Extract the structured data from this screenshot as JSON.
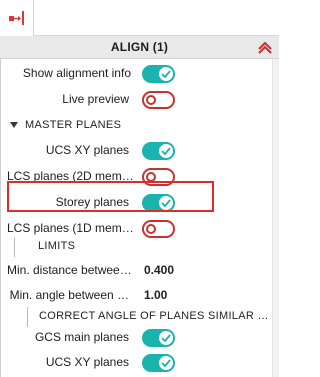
{
  "panel": {
    "title": "ALIGN (1)",
    "tab_icon": "align-tool-icon",
    "collapse_icon": "chevron-up-icon"
  },
  "rows": {
    "show_alignment_info": {
      "label": "Show alignment info",
      "state": "on"
    },
    "live_preview": {
      "label": "Live preview",
      "state": "off"
    }
  },
  "master_planes": {
    "title": "MASTER PLANES",
    "ucs_xy": {
      "label": "UCS XY planes",
      "state": "on"
    },
    "lcs_2d": {
      "label": "LCS planes (2D mem…",
      "state": "off"
    },
    "storey": {
      "label": "Storey planes",
      "state": "on"
    },
    "lcs_1d": {
      "label": "LCS planes (1D mem…",
      "state": "off"
    }
  },
  "limits": {
    "title": "LIMITS",
    "min_distance": {
      "label": "Min. distance betwee…",
      "value": "0.400"
    },
    "min_angle": {
      "label": "Min. angle between …",
      "value": "1.00"
    }
  },
  "correct_angle": {
    "title": "CORRECT ANGLE OF PLANES SIMILAR …",
    "gcs_main": {
      "label": "GCS main planes",
      "state": "on"
    },
    "ucs_xy": {
      "label": "UCS XY planes",
      "state": "on"
    }
  },
  "colors": {
    "toggle_on": "#1ab3ad",
    "toggle_off": "#c8312f",
    "highlight": "#e02b2b",
    "header_bg": "#e9e9e9"
  }
}
